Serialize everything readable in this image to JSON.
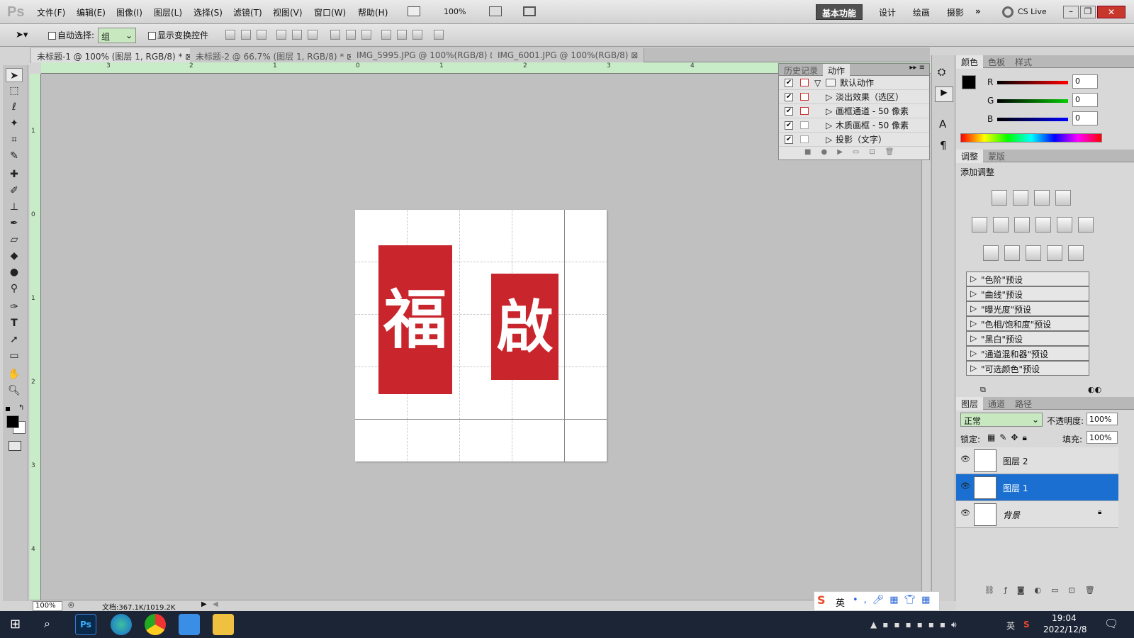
{
  "menubar": {
    "logo": "Ps",
    "items": [
      "文件(F)",
      "编辑(E)",
      "图像(I)",
      "图层(L)",
      "选择(S)",
      "滤镜(T)",
      "视图(V)",
      "窗口(W)",
      "帮助(H)"
    ],
    "zoom": "100%",
    "workspaces": [
      "基本功能",
      "设计",
      "绘画",
      "摄影"
    ],
    "more": "»",
    "cs_live": "CS Live"
  },
  "options": {
    "auto_select_label": "自动选择:",
    "auto_select_value": "组",
    "show_transform_label": "显示变换控件"
  },
  "tabs": [
    "未标题-1 @ 100% (图层 1, RGB/8) *",
    "未标题-2 @ 66.7% (图层 1, RGB/8) *",
    "IMG_5995.JPG @ 100%(RGB/8)",
    "IMG_6001.JPG @ 100%(RGB/8)"
  ],
  "rulers": {
    "top": [
      "3",
      "2",
      "1",
      "0",
      "1",
      "2",
      "3",
      "4"
    ],
    "left": [
      "1",
      "0",
      "1",
      "2",
      "3",
      "4"
    ]
  },
  "seals": {
    "left": "福",
    "right": "啟"
  },
  "status": {
    "zoom": "100%",
    "doc": "文档:367.1K/1019.2K"
  },
  "actions_panel": {
    "tabs": [
      "历史记录",
      "动作"
    ],
    "set": "默认动作",
    "items": [
      "淡出效果（选区）",
      "画框通道 - 50 像素",
      "木质画框 - 50 像素",
      "投影（文字）"
    ]
  },
  "color_panel": {
    "tabs": [
      "颜色",
      "色板",
      "样式"
    ],
    "channels": [
      {
        "label": "R",
        "value": "0"
      },
      {
        "label": "G",
        "value": "0"
      },
      {
        "label": "B",
        "value": "0"
      }
    ]
  },
  "adjust_panel": {
    "tabs": [
      "调整",
      "蒙版"
    ],
    "title": "添加调整",
    "presets": [
      "\"色阶\"预设",
      "\"曲线\"预设",
      "\"曝光度\"预设",
      "\"色相/饱和度\"预设",
      "\"黑白\"预设",
      "\"通道混和器\"预设",
      "\"可选颜色\"预设"
    ]
  },
  "layers_panel": {
    "tabs": [
      "图层",
      "通道",
      "路径"
    ],
    "blend": "正常",
    "opacity_label": "不透明度:",
    "opacity": "100%",
    "lock_label": "锁定:",
    "fill_label": "填充:",
    "fill": "100%",
    "layers": [
      "图层 2",
      "图层 1",
      "背景"
    ]
  },
  "ime": {
    "lang": "英"
  },
  "taskbar": {
    "time": "19:04",
    "date": "2022/12/8",
    "lang": "英"
  }
}
